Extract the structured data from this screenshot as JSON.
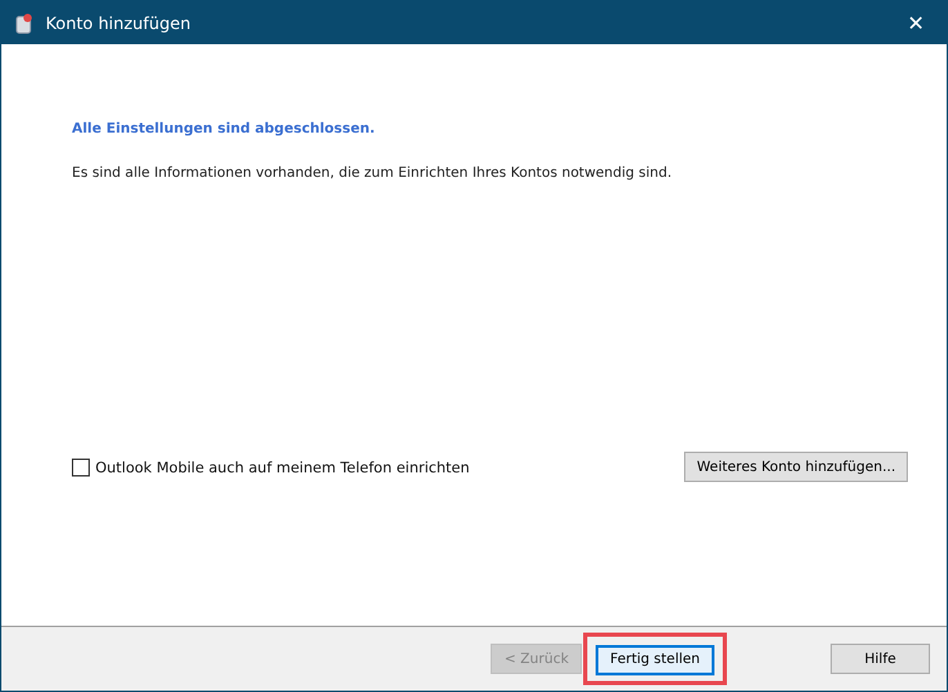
{
  "window": {
    "title": "Konto hinzufügen",
    "close": "✕"
  },
  "heading": "Alle Einstellungen sind abgeschlossen.",
  "message": "Es sind alle Informationen vorhanden, die zum Einrichten Ihres Kontos notwendig sind.",
  "checkbox": {
    "label": "Outlook Mobile auch auf meinem Telefon einrichten",
    "checked": false
  },
  "add_account_button": "Weiteres Konto hinzufügen...",
  "footer_buttons": [
    {
      "label": "< Zurück",
      "disabled": true,
      "default": false,
      "highlighted": false
    },
    {
      "label": "Fertig stellen",
      "disabled": false,
      "default": true,
      "highlighted": true
    }
  ],
  "help_button": "Hilfe"
}
